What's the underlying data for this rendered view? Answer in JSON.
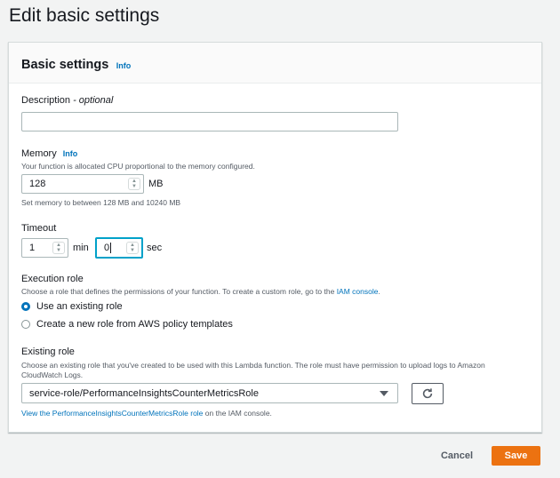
{
  "page": {
    "title": "Edit basic settings"
  },
  "panel": {
    "title": "Basic settings",
    "info": "Info"
  },
  "description": {
    "label": "Description",
    "optional": " - optional",
    "value": ""
  },
  "memory": {
    "label": "Memory",
    "info": "Info",
    "help": "Your function is allocated CPU proportional to the memory configured.",
    "value": "128",
    "unit": "MB",
    "constraint": "Set memory to between 128 MB and 10240 MB"
  },
  "timeout": {
    "label": "Timeout",
    "min_value": "1",
    "min_unit": "min",
    "sec_value": "0",
    "sec_unit": "sec"
  },
  "execution_role": {
    "label": "Execution role",
    "help_prefix": "Choose a role that defines the permissions of your function. To create a custom role, go to the ",
    "help_link": "IAM console",
    "help_suffix": ".",
    "options": [
      {
        "label": "Use an existing role",
        "selected": true
      },
      {
        "label": "Create a new role from AWS policy templates",
        "selected": false
      }
    ]
  },
  "existing_role": {
    "label": "Existing role",
    "help_line1": "Choose an existing role that you've created to be used with this Lambda function. The role must have permission to upload logs to Amazon",
    "help_line2": "CloudWatch Logs.",
    "value": "service-role/PerformanceInsightsCounterMetricsRole",
    "view_link": "View the PerformanceInsightsCounterMetricsRole role",
    "view_suffix": " on the IAM console."
  },
  "footer": {
    "cancel": "Cancel",
    "save": "Save"
  },
  "colors": {
    "accent": "#0073bb",
    "primary_button": "#ec7211",
    "focus": "#00a1c9"
  },
  "icons": {
    "refresh": "refresh-icon",
    "dropdown": "caret-down-icon",
    "stepper": "stepper-icon"
  }
}
